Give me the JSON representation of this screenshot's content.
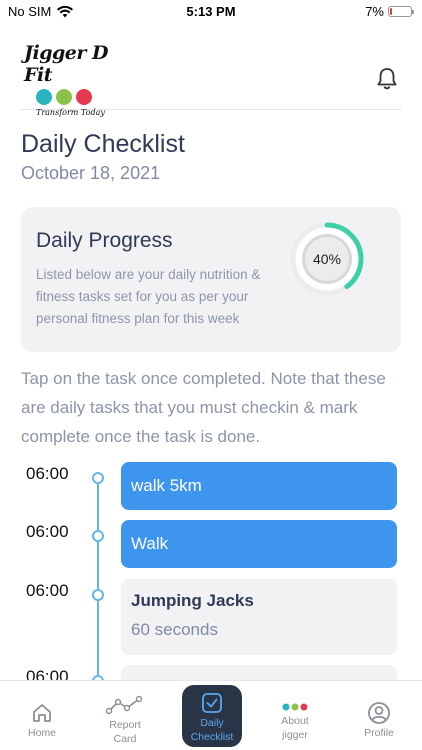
{
  "status_bar": {
    "carrier": "No SIM",
    "time": "5:13 PM",
    "battery_percent": "7%",
    "battery_level": 0.07
  },
  "header": {
    "logo_title": "Jigger D Fit",
    "logo_tagline": "Transform Today",
    "logo_icon_colors": [
      "#2bb3c0",
      "#8bc34a",
      "#e53950"
    ]
  },
  "page": {
    "title": "Daily Checklist",
    "date": "October 18, 2021"
  },
  "progress_card": {
    "title": "Daily Progress",
    "description": "Listed below are your daily nutrition & fitness tasks set for you as per your personal fitness plan for this week",
    "percent_label": "40%",
    "percent_value": 0.4,
    "ring_color": "#3ecfa6"
  },
  "instructions": "Tap on the task once completed. Note that these are daily tasks that you must checkin & mark complete once the task is done.",
  "tasks": [
    {
      "time": "06:00",
      "name": "walk 5km",
      "detail": "",
      "completed": true
    },
    {
      "time": "06:00",
      "name": "Walk",
      "detail": "",
      "completed": true
    },
    {
      "time": "06:00",
      "name": "Jumping Jacks",
      "detail": "60 seconds",
      "completed": false
    },
    {
      "time": "06:00",
      "name": "",
      "detail": "",
      "completed": false
    }
  ],
  "nav": {
    "home": "Home",
    "report_card_1": "Report",
    "report_card_2": "Card",
    "daily_checklist_1": "Daily",
    "daily_checklist_2": "Checklist",
    "about_1": "About",
    "about_2": "jigger",
    "profile": "Profile",
    "active_color": "#5aa8f0"
  }
}
